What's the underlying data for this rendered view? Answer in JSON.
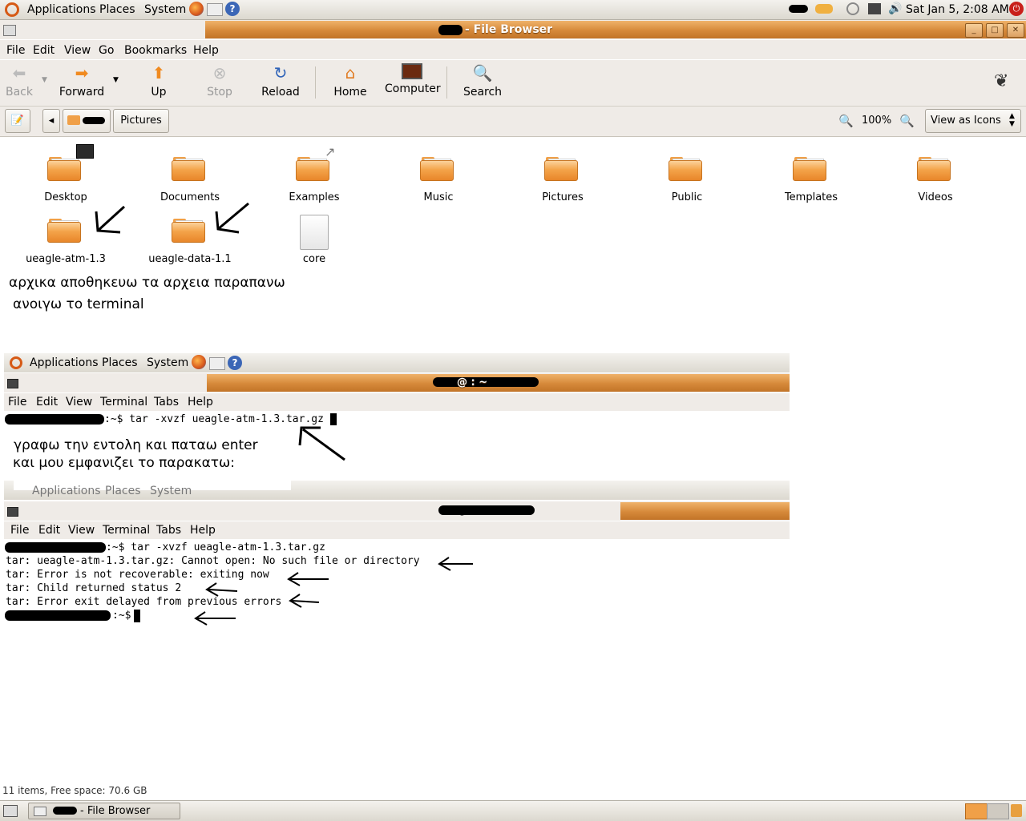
{
  "top_panel": {
    "menus": [
      "Applications",
      "Places",
      "System"
    ],
    "clock": "Sat Jan  5,  2:08 AM"
  },
  "window": {
    "title": "- File Browser",
    "menubar": [
      "File",
      "Edit",
      "View",
      "Go",
      "Bookmarks",
      "Help"
    ],
    "toolbar": {
      "back": "Back",
      "forward": "Forward",
      "up": "Up",
      "stop": "Stop",
      "reload": "Reload",
      "home": "Home",
      "computer": "Computer",
      "search": "Search"
    },
    "location": {
      "current": "Pictures",
      "zoom": "100%",
      "view_mode": "View as Icons"
    },
    "icons": [
      {
        "label": "Desktop"
      },
      {
        "label": "Documents"
      },
      {
        "label": "Examples"
      },
      {
        "label": "Music"
      },
      {
        "label": "Pictures"
      },
      {
        "label": "Public"
      },
      {
        "label": "Templates"
      },
      {
        "label": "Videos"
      },
      {
        "label": "ueagle-atm-1.3"
      },
      {
        "label": "ueagle-data-1.1"
      },
      {
        "label": "core"
      }
    ],
    "status": "11 items, Free space: 70.6 GB"
  },
  "annotations": {
    "note1_line1": "αρχικα αποθηκευω τα αρχεια παραπανω",
    "note1_line2": "ανοιγω το terminal",
    "note2_line1": "γραφω την εντολη και παταω enter",
    "note2_line2": "και μου εμφανιζει το παρακατω:"
  },
  "terminal1": {
    "panel_menus": [
      "Applications",
      "Places",
      "System"
    ],
    "title": "@ : ~",
    "menubar": [
      "File",
      "Edit",
      "View",
      "Terminal",
      "Tabs",
      "Help"
    ],
    "command": ":~$ tar -xvzf ueagle-atm-1.3.tar.gz"
  },
  "terminal2": {
    "panel_menus": [
      "Applications",
      "Places",
      "System"
    ],
    "title": "@ : ~",
    "menubar": [
      "File",
      "Edit",
      "View",
      "Terminal",
      "Tabs",
      "Help"
    ],
    "lines": [
      ":~$ tar -xvzf ueagle-atm-1.3.tar.gz",
      "tar: ueagle-atm-1.3.tar.gz: Cannot open: No such file or directory",
      "tar: Error is not recoverable: exiting now",
      "tar: Child returned status 2",
      "tar: Error exit delayed from previous errors",
      ":~$ "
    ]
  },
  "taskbar": {
    "item": "- File Browser"
  }
}
